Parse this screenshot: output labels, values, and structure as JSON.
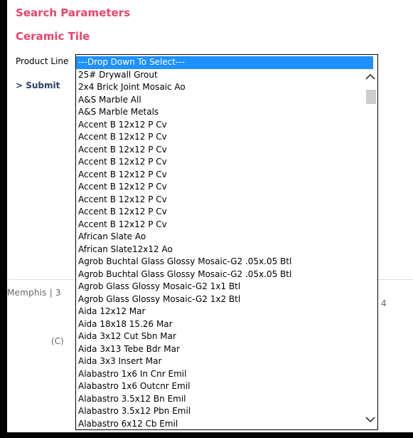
{
  "headings": {
    "search_parameters": "Search Parameters",
    "ceramic_tile": "Ceramic Tile"
  },
  "form": {
    "product_line_label": "Product Line",
    "submit_label": "> Submit"
  },
  "footer": {
    "left_text": "Memphis  |  3",
    "copyright": "(C)",
    "right_text": "4"
  },
  "dropdown": {
    "selected_value": "---Drop Down To Select---",
    "options": [
      "---Drop Down To Select---",
      "25# Drywall Grout",
      "2x4 Brick Joint Mosaic Ao",
      "A&S Marble All",
      "A&S Marble Metals",
      "Accent B 12x12 P Cv",
      "Accent B 12x12 P Cv",
      "Accent B 12x12 P Cv",
      "Accent B 12x12 P Cv",
      "Accent B 12x12 P Cv",
      "Accent B 12x12 P Cv",
      "Accent B 12x12 P Cv",
      "Accent B 12x12 P Cv",
      "Accent B 12x12 P Cv",
      "African Slate Ao",
      "African Slate12x12 Ao",
      "Agrob Buchtal Glass Glossy Mosaic-G2 .05x.05 Btl",
      "Agrob Buchtal Glass Glossy Mosaic-G2 .05x.05 Btl",
      "Agrob Glass Glossy Mosaic-G2 1x1 Btl",
      "Agrob Glass Glossy Mosaic-G2 1x2 Btl",
      "Aida 12x12 Mar",
      "Aida 18x18 15.26 Mar",
      "Aida 3x12 Cut Sbn Mar",
      "Aida 3x13 Tebe Bdr Mar",
      "Aida 3x3 Insert Mar",
      "Alabastro 1x6 In Cnr Emil",
      "Alabastro 1x6 Outcnr Emil",
      "Alabastro 3.5x12 Bn Emil",
      "Alabastro 3.5x12 Pbn Emil",
      "Alabastro 6x12 Cb Emil"
    ]
  },
  "colors": {
    "heading": "#e8456a",
    "submit": "#2a3e6b",
    "selection": "#1e90ff"
  },
  "icons": {
    "scroll_up": "chevron-up-icon",
    "scroll_down": "chevron-down-icon"
  }
}
